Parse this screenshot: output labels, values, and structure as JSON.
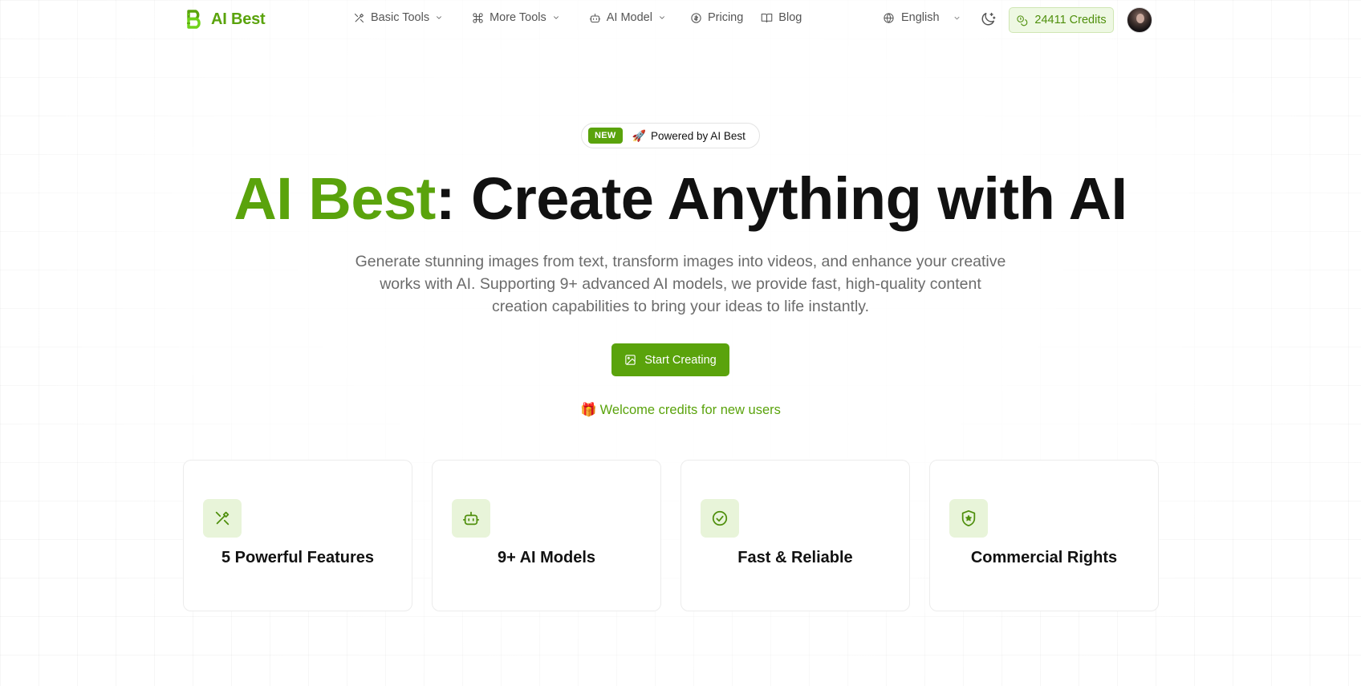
{
  "header": {
    "logo_text": "AI Best",
    "nav": [
      {
        "label": "Basic Tools",
        "icon": "tools-icon",
        "has_dropdown": true
      },
      {
        "label": "More Tools",
        "icon": "command-icon",
        "has_dropdown": true
      },
      {
        "label": "AI Model",
        "icon": "bot-icon",
        "has_dropdown": true
      },
      {
        "label": "Pricing",
        "icon": "coin-icon",
        "has_dropdown": false
      },
      {
        "label": "Blog",
        "icon": "book-icon",
        "has_dropdown": false
      }
    ],
    "language": "English",
    "credits_label": "24411 Credits"
  },
  "hero": {
    "badge_new": "NEW",
    "badge_text": "Powered by AI Best",
    "title_brand": "AI Best",
    "title_rest": ": Create Anything with AI",
    "subtitle": "Generate stunning images from text, transform images into videos, and enhance your creative works with AI. Supporting 9+ advanced AI models, we provide fast, high-quality content creation capabilities to bring your ideas to life instantly.",
    "cta_label": "Start Creating",
    "welcome_text": "Welcome credits for new users"
  },
  "features": [
    {
      "title": "5 Powerful Features",
      "icon": "tools-icon"
    },
    {
      "title": "9+ AI Models",
      "icon": "bot-icon"
    },
    {
      "title": "Fast & Reliable",
      "icon": "check-circle-icon"
    },
    {
      "title": "Commercial Rights",
      "icon": "shield-star-icon"
    }
  ],
  "colors": {
    "brand": "#5aa30c",
    "brand_light": "#e8f4d9",
    "text": "#111111",
    "muted": "#6b6b6b"
  }
}
